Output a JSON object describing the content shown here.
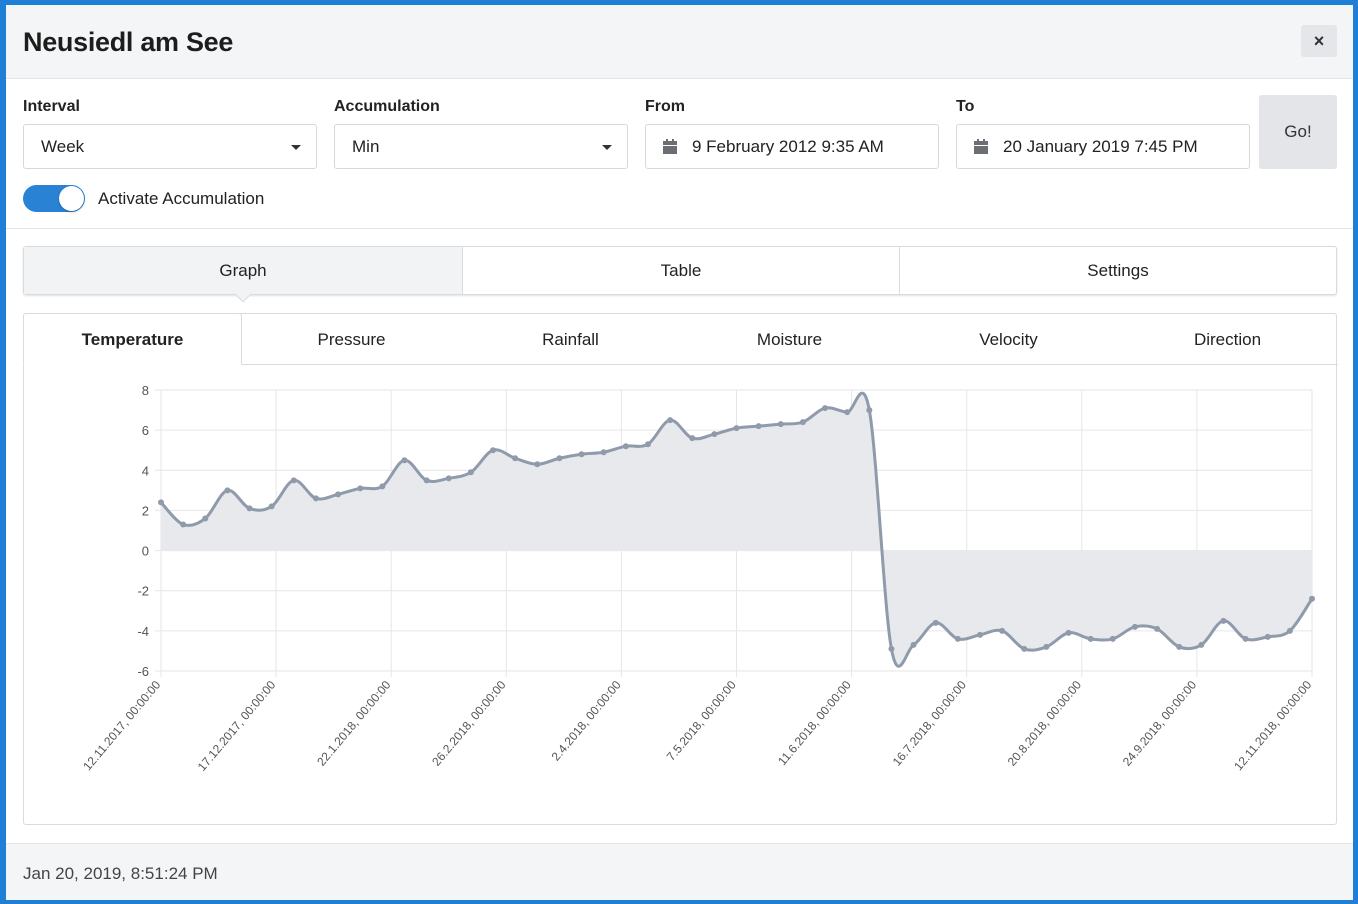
{
  "header": {
    "title": "Neusiedl am See",
    "close_label": "×"
  },
  "form": {
    "interval": {
      "label": "Interval",
      "value": "Week"
    },
    "accumulation": {
      "label": "Accumulation",
      "value": "Min"
    },
    "from": {
      "label": "From",
      "value": "9 February 2012 9:35 AM"
    },
    "to": {
      "label": "To",
      "value": "20 January 2019 7:45 PM"
    },
    "go_label": "Go!",
    "toggle": {
      "label": "Activate Accumulation",
      "on": true
    }
  },
  "view_tabs": [
    {
      "label": "Graph",
      "active": true
    },
    {
      "label": "Table",
      "active": false
    },
    {
      "label": "Settings",
      "active": false
    }
  ],
  "metric_tabs": [
    {
      "label": "Temperature",
      "active": true
    },
    {
      "label": "Pressure",
      "active": false
    },
    {
      "label": "Rainfall",
      "active": false
    },
    {
      "label": "Moisture",
      "active": false
    },
    {
      "label": "Velocity",
      "active": false
    },
    {
      "label": "Direction",
      "active": false
    }
  ],
  "colors": {
    "accent": "#2a82d5",
    "series_line": "#8f9aab",
    "series_fill": "#e8e9ed"
  },
  "chart_data": {
    "type": "area",
    "ylim": [
      -6,
      8
    ],
    "yticks": [
      8,
      6,
      4,
      2,
      0,
      -2,
      -4,
      -6
    ],
    "xtick_labels": [
      "12.11.2017, 00:00:00",
      "17.12.2017, 00:00:00",
      "22.1.2018, 00:00:00",
      "26.2.2018, 00:00:00",
      "2.4.2018, 00:00:00",
      "7.5.2018, 00:00:00",
      "11.6.2018, 00:00:00",
      "16.7.2018, 00:00:00",
      "20.8.2018, 00:00:00",
      "24.9.2018, 00:00:00",
      "12.11.2018, 00:00:00"
    ],
    "grid": true,
    "series": [
      {
        "values": [
          2.4,
          1.3,
          1.6,
          3.0,
          2.1,
          2.2,
          3.5,
          2.6,
          2.8,
          3.1,
          3.2,
          4.5,
          3.5,
          3.6,
          3.9,
          5.0,
          4.6,
          4.3,
          4.6,
          4.8,
          4.9,
          5.2,
          5.3,
          6.5,
          5.6,
          5.8,
          6.1,
          6.2,
          6.3,
          6.4,
          7.1,
          6.9,
          7.0,
          -4.9,
          -4.7,
          -3.6,
          -4.4,
          -4.2,
          -4.0,
          -4.9,
          -4.8,
          -4.1,
          -4.4,
          -4.4,
          -3.8,
          -3.9,
          -4.8,
          -4.7,
          -3.5,
          -4.4,
          -4.3,
          -4.0,
          -2.4
        ]
      }
    ]
  },
  "footer": {
    "timestamp": "Jan 20, 2019, 8:51:24 PM"
  }
}
